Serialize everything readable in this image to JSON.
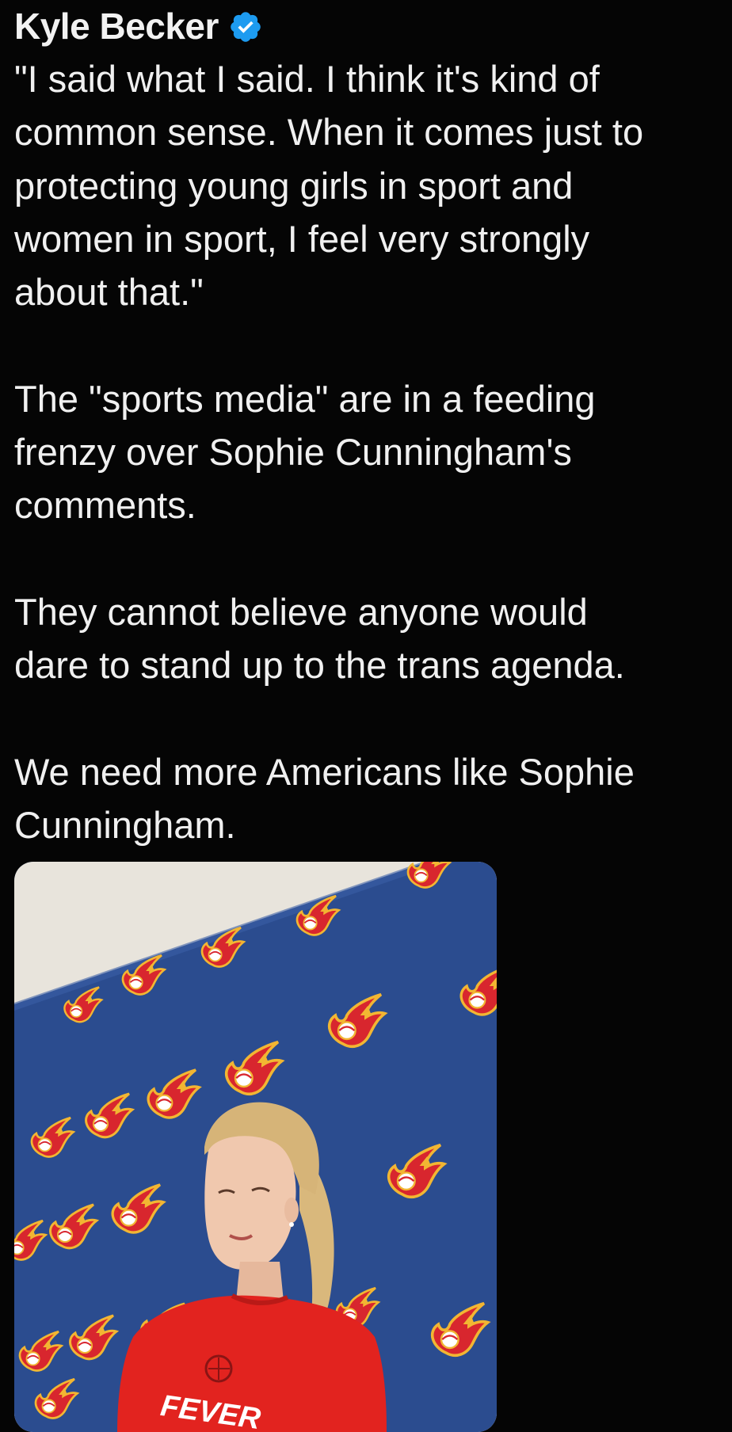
{
  "tweet": {
    "author_name": "Kyle Becker",
    "verified_icon": "verified-badge-icon",
    "paragraphs": [
      "\"I said what I said. I think it's kind of common sense.  When it comes just to protecting young girls in sport and women in sport, I feel very strongly about that.\"",
      "The \"sports media\" are in a feeding frenzy over Sophie Cunningham's comments.",
      "They cannot believe anyone would dare to stand up to the trans agenda.",
      "We need more Americans like Sophie Cunningham."
    ],
    "lines": [
      [
        "\"I said what I said. I think it's kind of",
        "common sense.  When it comes just to",
        "protecting young girls in sport and",
        "women in sport, I feel very strongly",
        "about that.\""
      ],
      [
        "The \"sports media\" are in a feeding",
        "frenzy over Sophie Cunningham's",
        "comments."
      ],
      [
        "They cannot believe anyone would",
        "dare to stand up to the trans agenda."
      ],
      [
        "We need more Americans like Sophie",
        "Cunningham."
      ]
    ]
  },
  "media": {
    "shirt_text": "FEVER",
    "colors": {
      "backdrop": "#2b4c8f",
      "wall": "#e8e4dc",
      "shirt": "#e2231f",
      "logo_red": "#d8262e",
      "logo_gold": "#f2b632"
    }
  },
  "colors": {
    "background": "#050505",
    "text": "#f0f0f0",
    "verified": "#1d9bf0"
  }
}
